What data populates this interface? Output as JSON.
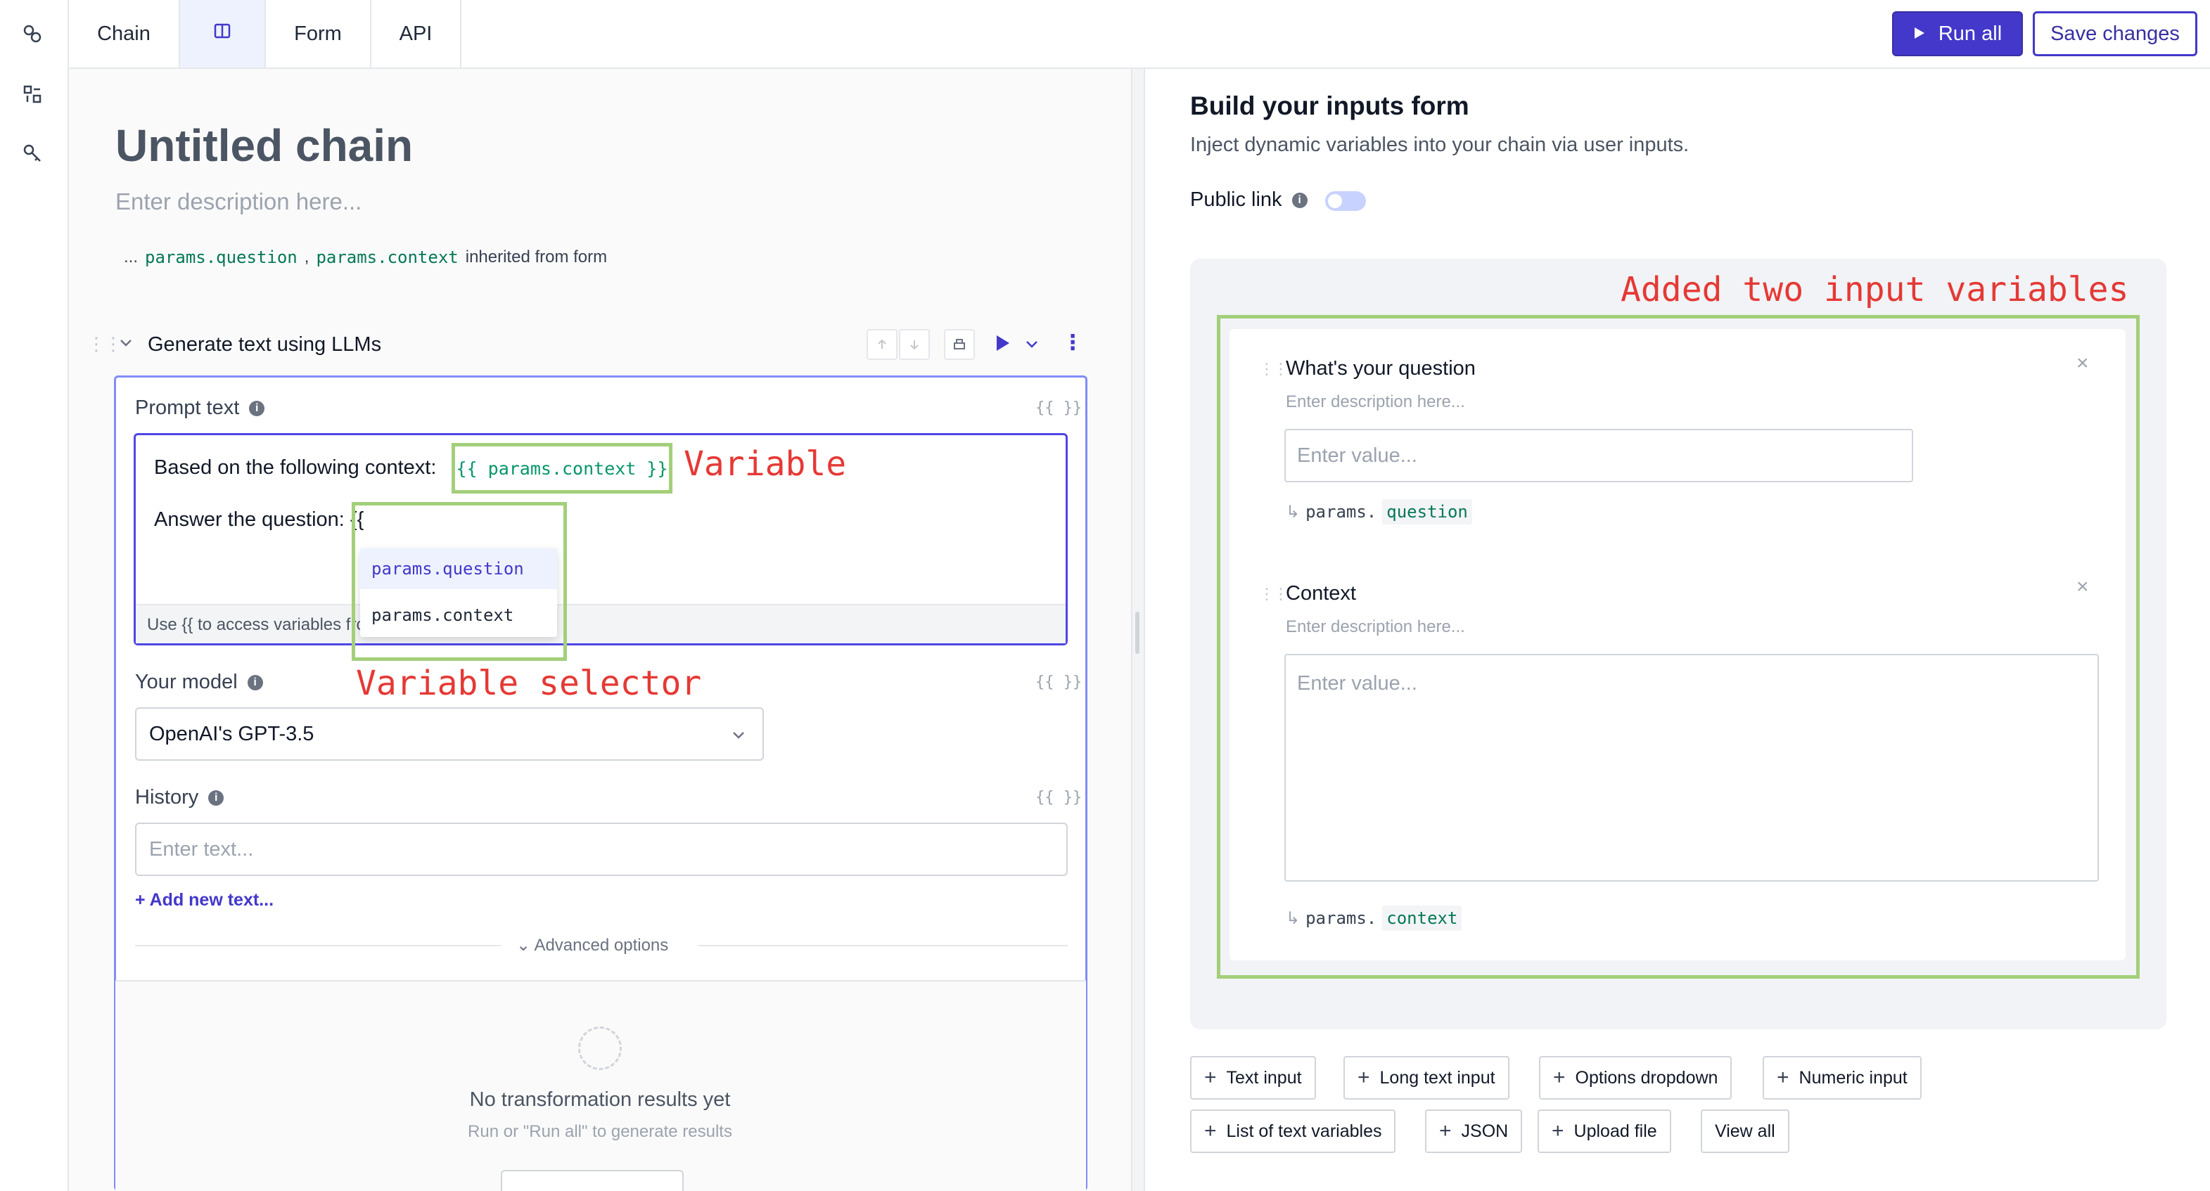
{
  "topbar": {
    "tabs": [
      {
        "label": "Chain"
      },
      {
        "label": ""
      },
      {
        "label": "Form"
      },
      {
        "label": "API"
      }
    ],
    "run_all": "Run all",
    "save_changes": "Save changes"
  },
  "chain": {
    "title": "Untitled chain",
    "description_placeholder": "Enter description here...",
    "inherit_ellipsis": "...",
    "inherit_var1": "params.question",
    "inherit_sep": ",",
    "inherit_var2": "params.context",
    "inherit_suffix": "inherited from form"
  },
  "step": {
    "title": "Generate text using LLMs",
    "prompt_label": "Prompt text",
    "brace_hint": "{{ }}",
    "prompt_line1": "Based on the following context:",
    "prompt_var": "{{ params.context }}",
    "prompt_line2": "Answer the question: {{",
    "prompt_footer": "Use {{ to access variables from your form",
    "dropdown_options": [
      "params.question",
      "params.context"
    ],
    "model_label": "Your model",
    "model_value": "OpenAI's GPT-3.5",
    "history_label": "History",
    "history_placeholder": "Enter text...",
    "add_new_text": "+ Add new text...",
    "advanced_options": "Advanced options",
    "no_results": "No transformation results yet",
    "no_results_sub": "Run or \"Run all\" to generate results"
  },
  "annotations": {
    "variable": "Variable",
    "variable_selector": "Variable selector",
    "added_inputs": "Added two input variables"
  },
  "form": {
    "title": "Build your inputs form",
    "subtitle": "Inject dynamic variables into your chain via user inputs.",
    "public_link": "Public link",
    "fields": [
      {
        "title": "What's your question",
        "description": "Enter description here...",
        "placeholder": "Enter value...",
        "param_prefix": "params.",
        "param_name": "question"
      },
      {
        "title": "Context",
        "description": "Enter description here...",
        "placeholder": "Enter value...",
        "param_prefix": "params.",
        "param_name": "context"
      }
    ],
    "add_buttons": [
      "Text input",
      "Long text input",
      "Options dropdown",
      "Numeric input",
      "List of text variables",
      "JSON",
      "Upload file",
      "View all"
    ]
  },
  "colors": {
    "accent": "#4338ca",
    "annotation_red": "#e53935",
    "annotation_green": "#a3cf7a",
    "variable_green": "#047857"
  }
}
